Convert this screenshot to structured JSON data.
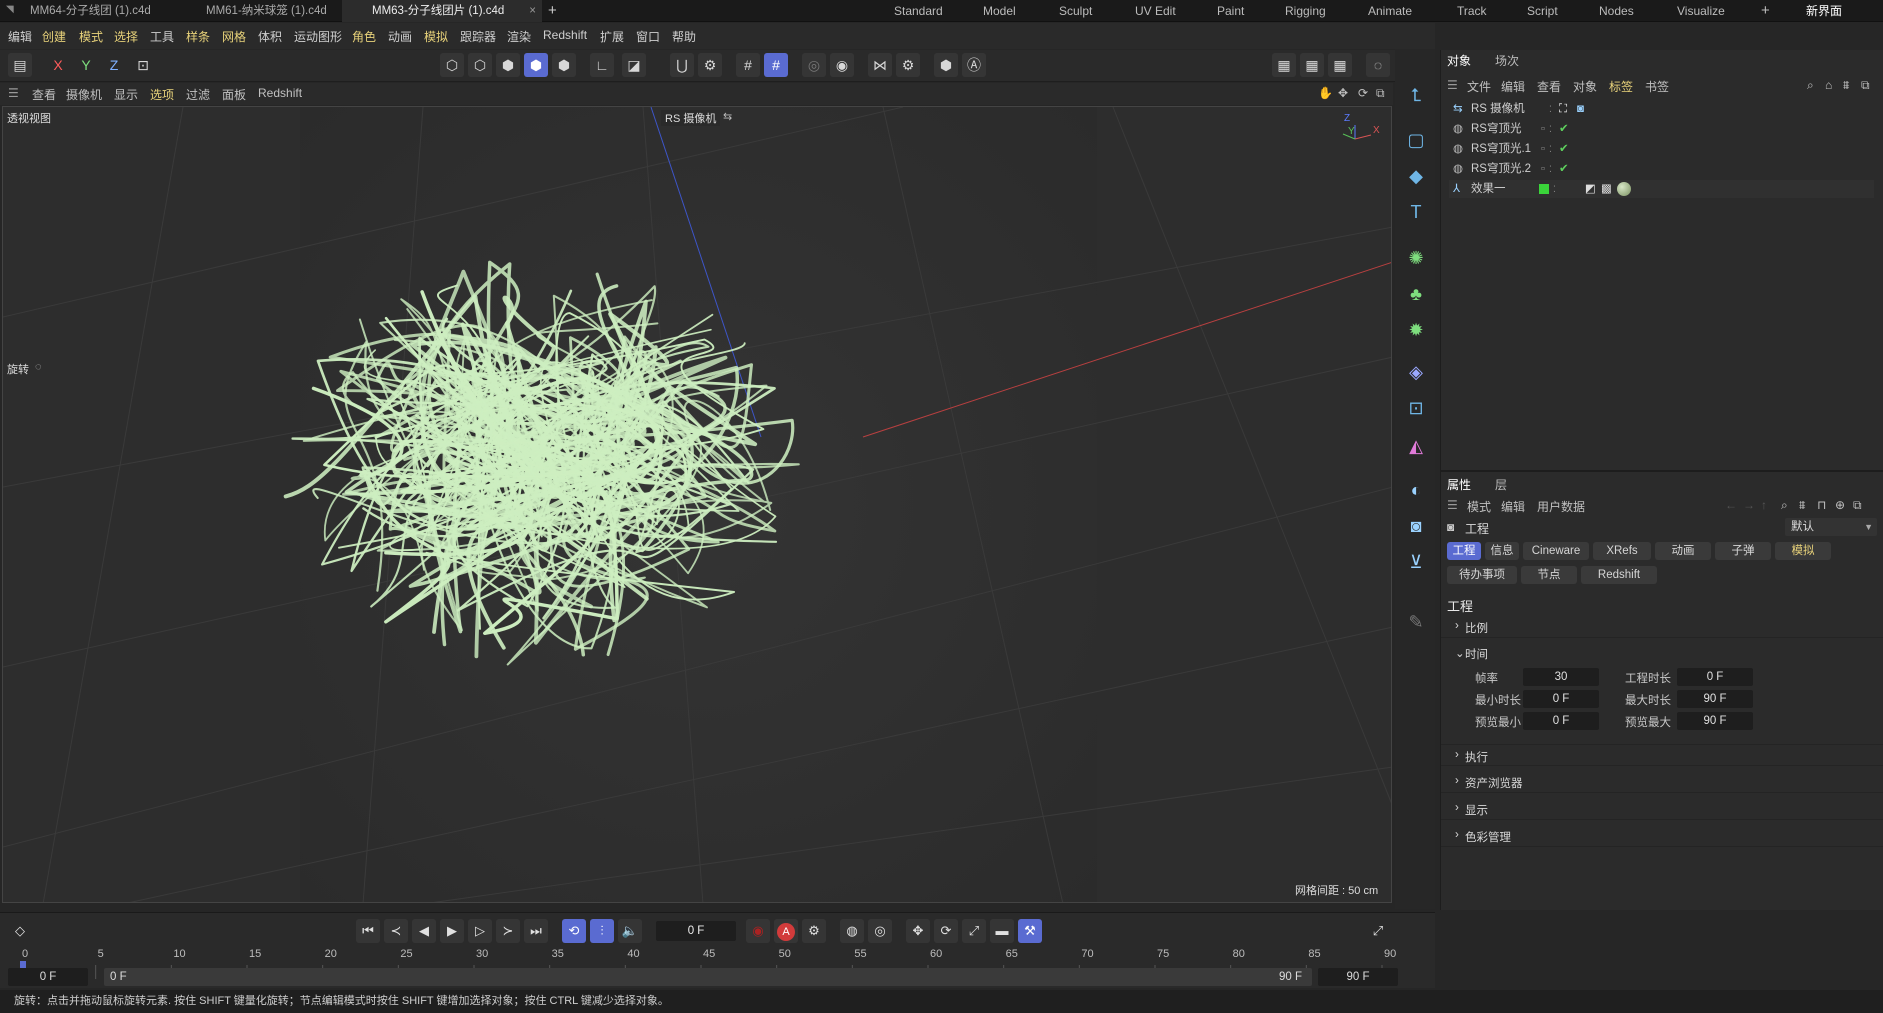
{
  "titlebar": {
    "file_tabs": [
      "MM64-分子线团 (1).c4d",
      "MM61-纳米球笼 (1).c4d",
      "MM63-分子线团片 (1).c4d"
    ],
    "close": "×",
    "new_tab": "+",
    "layouts": [
      "Standard",
      "Model",
      "Sculpt",
      "UV Edit",
      "Paint",
      "Rigging",
      "Animate",
      "Track",
      "Script",
      "Nodes",
      "Visualize"
    ],
    "add_layout": "+",
    "new_ui": "新界面"
  },
  "menubar": [
    "编辑",
    "创建",
    "模式",
    "选择",
    "工具",
    "样条",
    "网格",
    "体积",
    "运动图形",
    "角色",
    "动画",
    "模拟",
    "跟踪器",
    "渲染",
    "Redshift",
    "扩展",
    "窗口",
    "帮助"
  ],
  "toolbar": {
    "axes": [
      "X",
      "Y",
      "Z"
    ]
  },
  "viewmenu": [
    "查看",
    "摄像机",
    "显示",
    "选项",
    "过滤",
    "面板",
    "Redshift"
  ],
  "viewport": {
    "name": "透视视图",
    "camera": "RS 摄像机",
    "rotate_label": "旋转",
    "grid_info": "网格间距 : 50 cm",
    "axis": {
      "z": "Z",
      "y": "Y",
      "x": "X"
    },
    "strand_color": "#cdeec0"
  },
  "object_panel": {
    "tabs": [
      "对象",
      "场次"
    ],
    "menu": [
      "文件",
      "编辑",
      "查看",
      "对象",
      "标签",
      "书签"
    ],
    "objects": [
      {
        "name": "RS 摄像机",
        "icon": "camera-icon"
      },
      {
        "name": "RS穹顶光",
        "icon": "light-icon"
      },
      {
        "name": "RS穹顶光.1",
        "icon": "light-icon"
      },
      {
        "name": "RS穹顶光.2",
        "icon": "light-icon"
      },
      {
        "name": "效果一",
        "icon": "effector-icon"
      }
    ]
  },
  "attr_panel": {
    "tabs": [
      "属性",
      "层"
    ],
    "menu": [
      "模式",
      "编辑",
      "用户数据"
    ],
    "object_type": "工程",
    "preset": "默认",
    "chips_row1": [
      "工程",
      "信息",
      "Cineware",
      "XRefs",
      "动画",
      "子弹",
      "模拟"
    ],
    "chips_row2": [
      "待办事项",
      "节点",
      "Redshift"
    ],
    "heading": "工程",
    "sections": [
      "比例",
      "时间",
      "执行",
      "资产浏览器",
      "显示",
      "色彩管理"
    ],
    "time_fields": [
      {
        "label": "帧率",
        "value": "30"
      },
      {
        "label": "工程时长",
        "value": "0 F"
      },
      {
        "label": "最小时长",
        "value": "0 F"
      },
      {
        "label": "最大时长",
        "value": "90 F"
      },
      {
        "label": "预览最小",
        "value": "0 F"
      },
      {
        "label": "预览最大",
        "value": "90 F"
      }
    ]
  },
  "timeline": {
    "current_frame": "0 F",
    "ticks": [
      "0",
      "5",
      "10",
      "15",
      "20",
      "25",
      "30",
      "35",
      "40",
      "45",
      "50",
      "55",
      "60",
      "65",
      "70",
      "75",
      "80",
      "85",
      "90"
    ],
    "range_start": "0 F",
    "range_start2": "0 F",
    "range_end": "90 F",
    "range_end2": "90 F"
  },
  "status": "旋转：点击并拖动鼠标旋转元素. 按住 SHIFT 键量化旋转；节点编辑模式时按住 SHIFT 键增加选择对象；按住 CTRL 键减少选择对象。"
}
